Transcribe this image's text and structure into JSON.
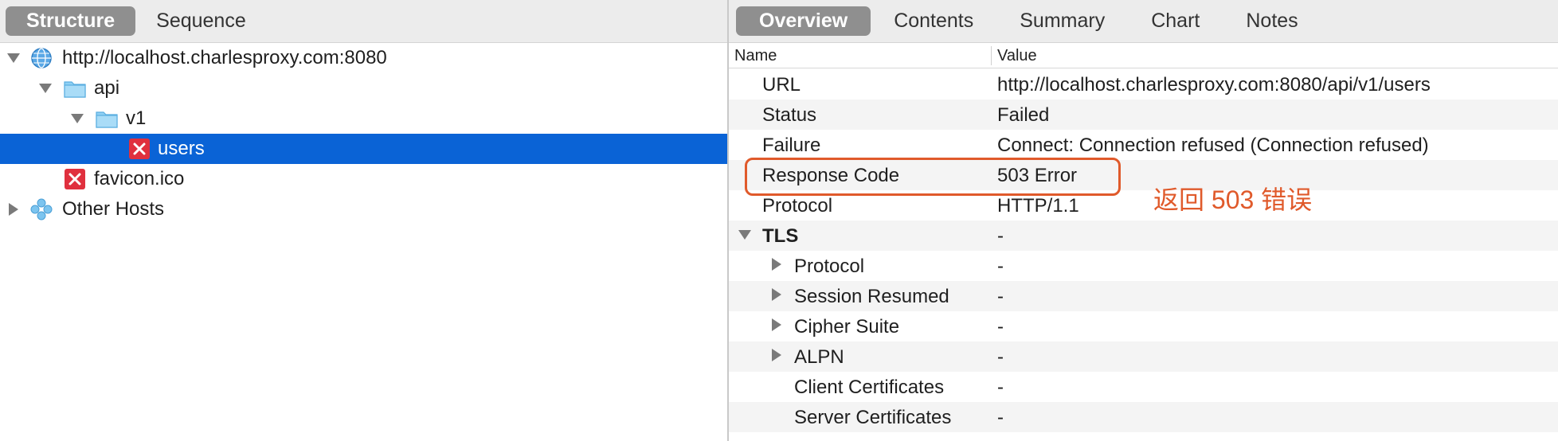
{
  "left_tabs": {
    "structure": "Structure",
    "sequence": "Sequence"
  },
  "tree": {
    "host": "http://localhost.charlesproxy.com:8080",
    "api": "api",
    "v1": "v1",
    "users": "users",
    "favicon": "favicon.ico",
    "other_hosts": "Other Hosts"
  },
  "right_tabs": {
    "overview": "Overview",
    "contents": "Contents",
    "summary": "Summary",
    "chart": "Chart",
    "notes": "Notes"
  },
  "table": {
    "header_name": "Name",
    "header_value": "Value",
    "rows": [
      {
        "name": "URL",
        "value": "http://localhost.charlesproxy.com:8080/api/v1/users"
      },
      {
        "name": "Status",
        "value": "Failed"
      },
      {
        "name": "Failure",
        "value": "Connect: Connection refused (Connection refused)"
      },
      {
        "name": "Response Code",
        "value": "503 Error"
      },
      {
        "name": "Protocol",
        "value": "HTTP/1.1"
      },
      {
        "name": "TLS",
        "value": "-"
      },
      {
        "name": "Protocol",
        "value": "-"
      },
      {
        "name": "Session Resumed",
        "value": "-"
      },
      {
        "name": "Cipher Suite",
        "value": "-"
      },
      {
        "name": "ALPN",
        "value": "-"
      },
      {
        "name": "Client Certificates",
        "value": "-"
      },
      {
        "name": "Server Certificates",
        "value": "-"
      }
    ]
  },
  "annotation": "返回 503 错误",
  "colors": {
    "selection": "#0a63d6",
    "annotation": "#e05a2b",
    "error_icon": "#e0303e",
    "folder": "#7cc4ef"
  }
}
